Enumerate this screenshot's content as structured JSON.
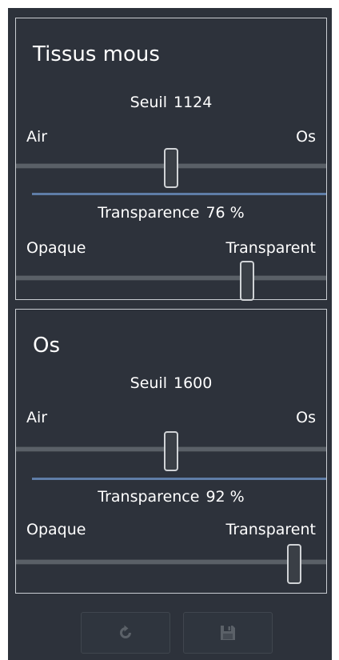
{
  "panels": [
    {
      "title": "Tissus mous",
      "threshold": {
        "label": "Seuil",
        "value": "1124",
        "min_label": "Air",
        "max_label": "Os",
        "slider_fraction": 0.5
      },
      "transparency": {
        "label": "Transparence",
        "value": "76 %",
        "min_label": "Opaque",
        "max_label": "Transparent",
        "slider_fraction": 0.76
      }
    },
    {
      "title": "Os",
      "threshold": {
        "label": "Seuil",
        "value": "1600",
        "min_label": "Air",
        "max_label": "Os",
        "slider_fraction": 0.5
      },
      "transparency": {
        "label": "Transparence",
        "value": "92 %",
        "min_label": "Opaque",
        "max_label": "Transparent",
        "slider_fraction": 0.92
      }
    }
  ],
  "footer": {
    "reset_icon": "reset-icon",
    "save_icon": "save-icon"
  },
  "colors": {
    "background": "#2d323b",
    "panel_border": "#c9cdd2",
    "divider": "#5f7da7",
    "text": "#ffffff"
  }
}
